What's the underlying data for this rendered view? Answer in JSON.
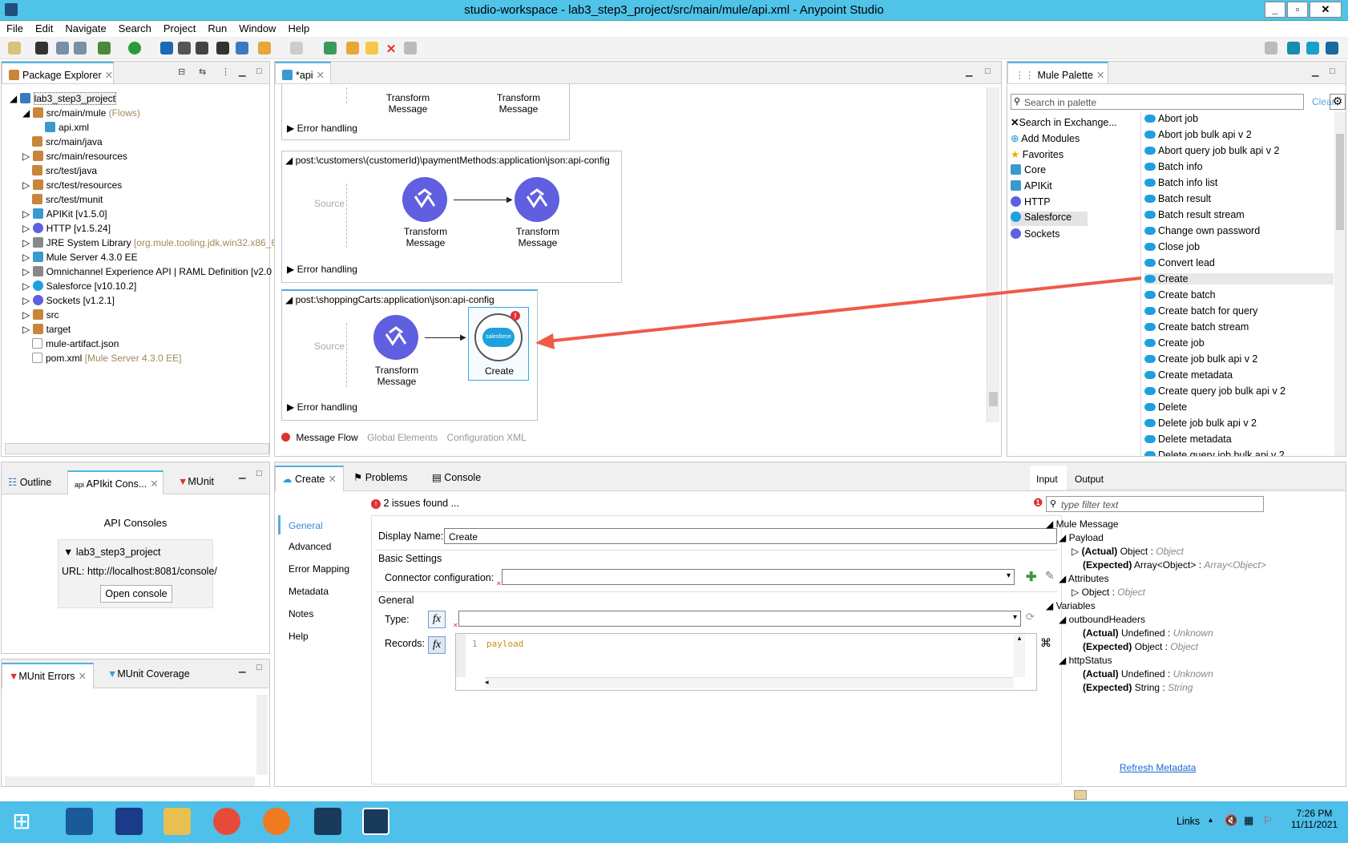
{
  "window": {
    "title": "studio-workspace - lab3_step3_project/src/main/mule/api.xml - Anypoint Studio"
  },
  "menu": [
    "File",
    "Edit",
    "Navigate",
    "Search",
    "Project",
    "Run",
    "Window",
    "Help"
  ],
  "package_explorer": {
    "tab": "Package Explorer",
    "items": [
      {
        "label": "lab3_step3_project",
        "extra": ""
      },
      {
        "label": "src/main/mule",
        "extra": "(Flows)"
      },
      {
        "label": "api.xml",
        "extra": ""
      },
      {
        "label": "src/main/java",
        "extra": ""
      },
      {
        "label": "src/main/resources",
        "extra": ""
      },
      {
        "label": "src/test/java",
        "extra": ""
      },
      {
        "label": "src/test/resources",
        "extra": ""
      },
      {
        "label": "src/test/munit",
        "extra": ""
      },
      {
        "label": "APIKit [v1.5.0]",
        "extra": ""
      },
      {
        "label": "HTTP [v1.5.24]",
        "extra": ""
      },
      {
        "label": "JRE System Library",
        "extra": "[org.mule.tooling.jdk.win32.x86_6"
      },
      {
        "label": "Mule Server 4.3.0 EE",
        "extra": ""
      },
      {
        "label": "Omnichannel Experience API | RAML Definition [v2.0",
        "extra": ""
      },
      {
        "label": "Salesforce [v10.10.2]",
        "extra": ""
      },
      {
        "label": "Sockets [v1.2.1]",
        "extra": ""
      },
      {
        "label": "src",
        "extra": ""
      },
      {
        "label": "target",
        "extra": ""
      },
      {
        "label": "mule-artifact.json",
        "extra": ""
      },
      {
        "label": "pom.xml",
        "extra": "[Mule Server 4.3.0 EE]"
      }
    ]
  },
  "editor": {
    "tab": "*api",
    "flow1": {
      "node1": "Transform\nMessage",
      "node2": "Transform\nMessage",
      "error": "Error handling"
    },
    "flow2": {
      "header": "post:\\customers\\(customerId)\\paymentMethods:application\\json:api-config",
      "source": "Source",
      "node1": "Transform\nMessage",
      "node2": "Transform\nMessage",
      "error": "Error handling"
    },
    "flow3": {
      "header": "post:\\shoppingCarts:application\\json:api-config",
      "source": "Source",
      "node1": "Transform\nMessage",
      "node2": "Create",
      "error": "Error handling",
      "sf_badge": "salesforce"
    },
    "bottom_tabs": [
      "Message Flow",
      "Global Elements",
      "Configuration XML"
    ]
  },
  "palette": {
    "tab": "Mule Palette",
    "search_placeholder": "Search in palette",
    "clear": "Clear",
    "categories": [
      "Search in Exchange...",
      "Add Modules",
      "Favorites",
      "Core",
      "APIKit",
      "HTTP",
      "Salesforce",
      "Sockets"
    ],
    "operations": [
      "Abort job",
      "Abort job bulk api v 2",
      "Abort query job bulk api v 2",
      "Batch info",
      "Batch info list",
      "Batch result",
      "Batch result stream",
      "Change own password",
      "Close job",
      "Convert lead",
      "Create",
      "Create batch",
      "Create batch for query",
      "Create batch stream",
      "Create job",
      "Create job bulk api v 2",
      "Create metadata",
      "Create query job bulk api v 2",
      "Delete",
      "Delete job bulk api v 2",
      "Delete metadata",
      "Delete query job bulk api v 2"
    ]
  },
  "left_bottom": {
    "tabs": [
      "Outline",
      "APIkit Cons...",
      "MUnit"
    ],
    "title": "API Consoles",
    "project": "lab3_step3_project",
    "url": "URL: http://localhost:8081/console/",
    "button": "Open console"
  },
  "munit": {
    "tabs": [
      "MUnit Errors",
      "MUnit Coverage"
    ]
  },
  "props": {
    "tabs": [
      "Create",
      "Problems",
      "Console"
    ],
    "issues": "2 issues found ...",
    "nav": [
      "General",
      "Advanced",
      "Error Mapping",
      "Metadata",
      "Notes",
      "Help"
    ],
    "display_name_label": "Display Name:",
    "display_name": "Create",
    "basic_settings": "Basic Settings",
    "connector_label": "Connector configuration:",
    "general": "General",
    "type_label": "Type:",
    "records_label": "Records:",
    "line_no": "1",
    "code": "payload"
  },
  "metadata": {
    "tabs": [
      "Input",
      "Output"
    ],
    "filter_placeholder": "type filter text",
    "rows": [
      {
        "t": "Mule Message",
        "b": "",
        "i": ""
      },
      {
        "t": "Payload",
        "b": "",
        "i": ""
      },
      {
        "t": "Object : ",
        "b": "(Actual)",
        "i": "Object"
      },
      {
        "t": "Array<Object> : ",
        "b": "(Expected)",
        "i": "Array<Object>"
      },
      {
        "t": "Attributes",
        "b": "",
        "i": ""
      },
      {
        "t": "Object : ",
        "b": "",
        "i": "Object"
      },
      {
        "t": "Variables",
        "b": "",
        "i": ""
      },
      {
        "t": "outboundHeaders",
        "b": "",
        "i": ""
      },
      {
        "t": "Undefined : ",
        "b": "(Actual)",
        "i": "Unknown"
      },
      {
        "t": "Object : ",
        "b": "(Expected)",
        "i": "Object"
      },
      {
        "t": "httpStatus",
        "b": "",
        "i": ""
      },
      {
        "t": "Undefined : ",
        "b": "(Actual)",
        "i": "Unknown"
      },
      {
        "t": "String : ",
        "b": "(Expected)",
        "i": "String"
      }
    ],
    "refresh": "Refresh Metadata"
  },
  "taskbar": {
    "links": "Links",
    "time": "7:26 PM",
    "date": "11/11/2021"
  },
  "colors": {
    "accent": "#4fc3e8",
    "arrow": "#f05a48",
    "node": "#5f5fe0"
  }
}
